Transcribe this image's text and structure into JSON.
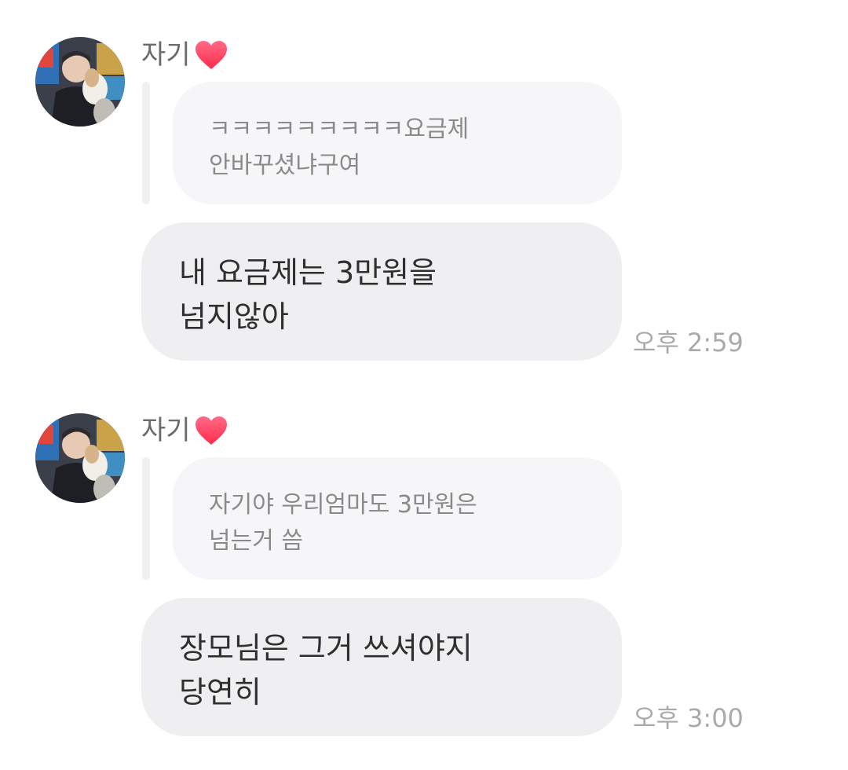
{
  "messages": [
    {
      "sender": "자기",
      "quote": "ㅋㅋㅋㅋㅋㅋㅋㅋㅋ요금제\n안바꾸셨냐구여",
      "text": "내 요금제는 3만원을\n넘지않아",
      "time": "오후 2:59"
    },
    {
      "sender": "자기",
      "quote": "자기야 우리엄마도 3만원은\n넘는거 씀",
      "text": "장모님은 그거 쓰셔야지\n당연히",
      "time": "오후 3:00"
    }
  ],
  "colors": {
    "heart": "#ff3b5c",
    "bubble": "#efeff1",
    "quote_bubble": "#f6f6f8",
    "timestamp": "#aaaaaa"
  },
  "icons": {
    "heart": "heart-icon",
    "avatar": "avatar"
  }
}
